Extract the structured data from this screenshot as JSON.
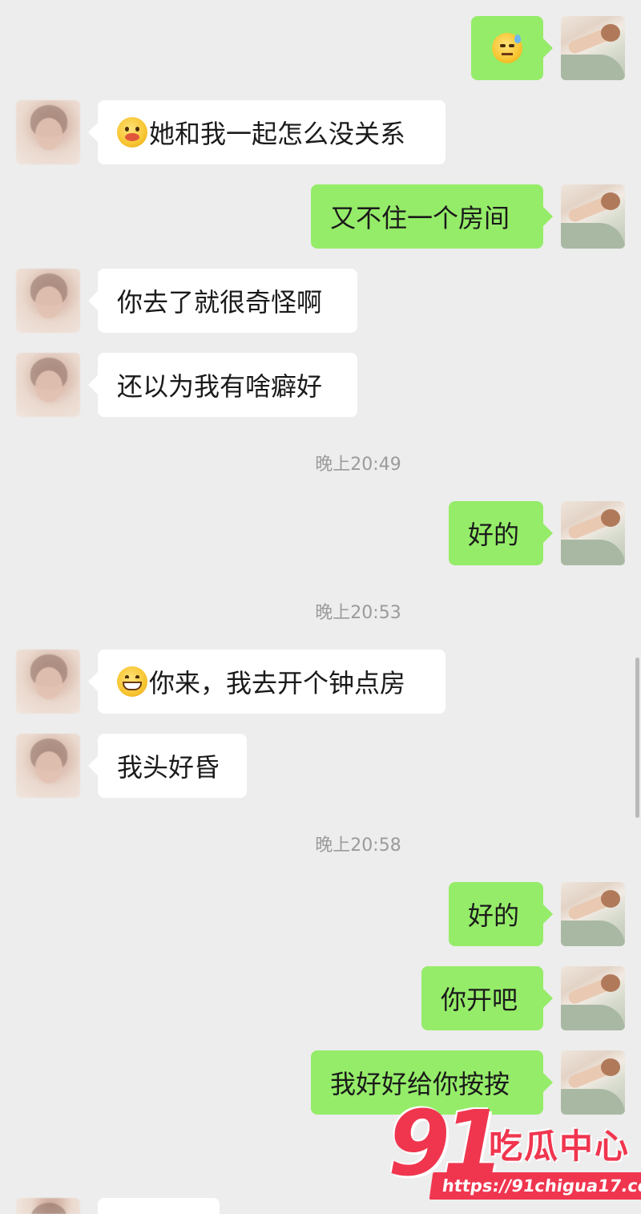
{
  "messages": [
    {
      "from": "me",
      "emoji": "sweat-emoji",
      "text": ""
    },
    {
      "from": "other",
      "emoji": "eating-emoji",
      "text": "她和我一起怎么没关系"
    },
    {
      "from": "me",
      "text": "又不住一个房间"
    },
    {
      "from": "other",
      "text": "你去了就很奇怪啊"
    },
    {
      "from": "other",
      "text": "还以为我有啥癖好"
    },
    {
      "timestamp": "晚上20:49"
    },
    {
      "from": "me",
      "text": "好的"
    },
    {
      "timestamp": "晚上20:53"
    },
    {
      "from": "other",
      "emoji": "grin-emoji",
      "text": "你来，我去开个钟点房"
    },
    {
      "from": "other",
      "text": "我头好昏"
    },
    {
      "timestamp": "晚上20:58"
    },
    {
      "from": "me",
      "text": "好的"
    },
    {
      "from": "me",
      "text": "你开吧"
    },
    {
      "from": "me",
      "text": "我好好给你按按"
    }
  ],
  "watermark": {
    "number": "91",
    "title": "吃瓜中心",
    "url": "https://91chigua17.com",
    "color": "#f0364f"
  },
  "colors": {
    "background": "#ededed",
    "bubble_me": "#95ec69",
    "bubble_other": "#ffffff",
    "timestamp": "#9b9b9b"
  }
}
